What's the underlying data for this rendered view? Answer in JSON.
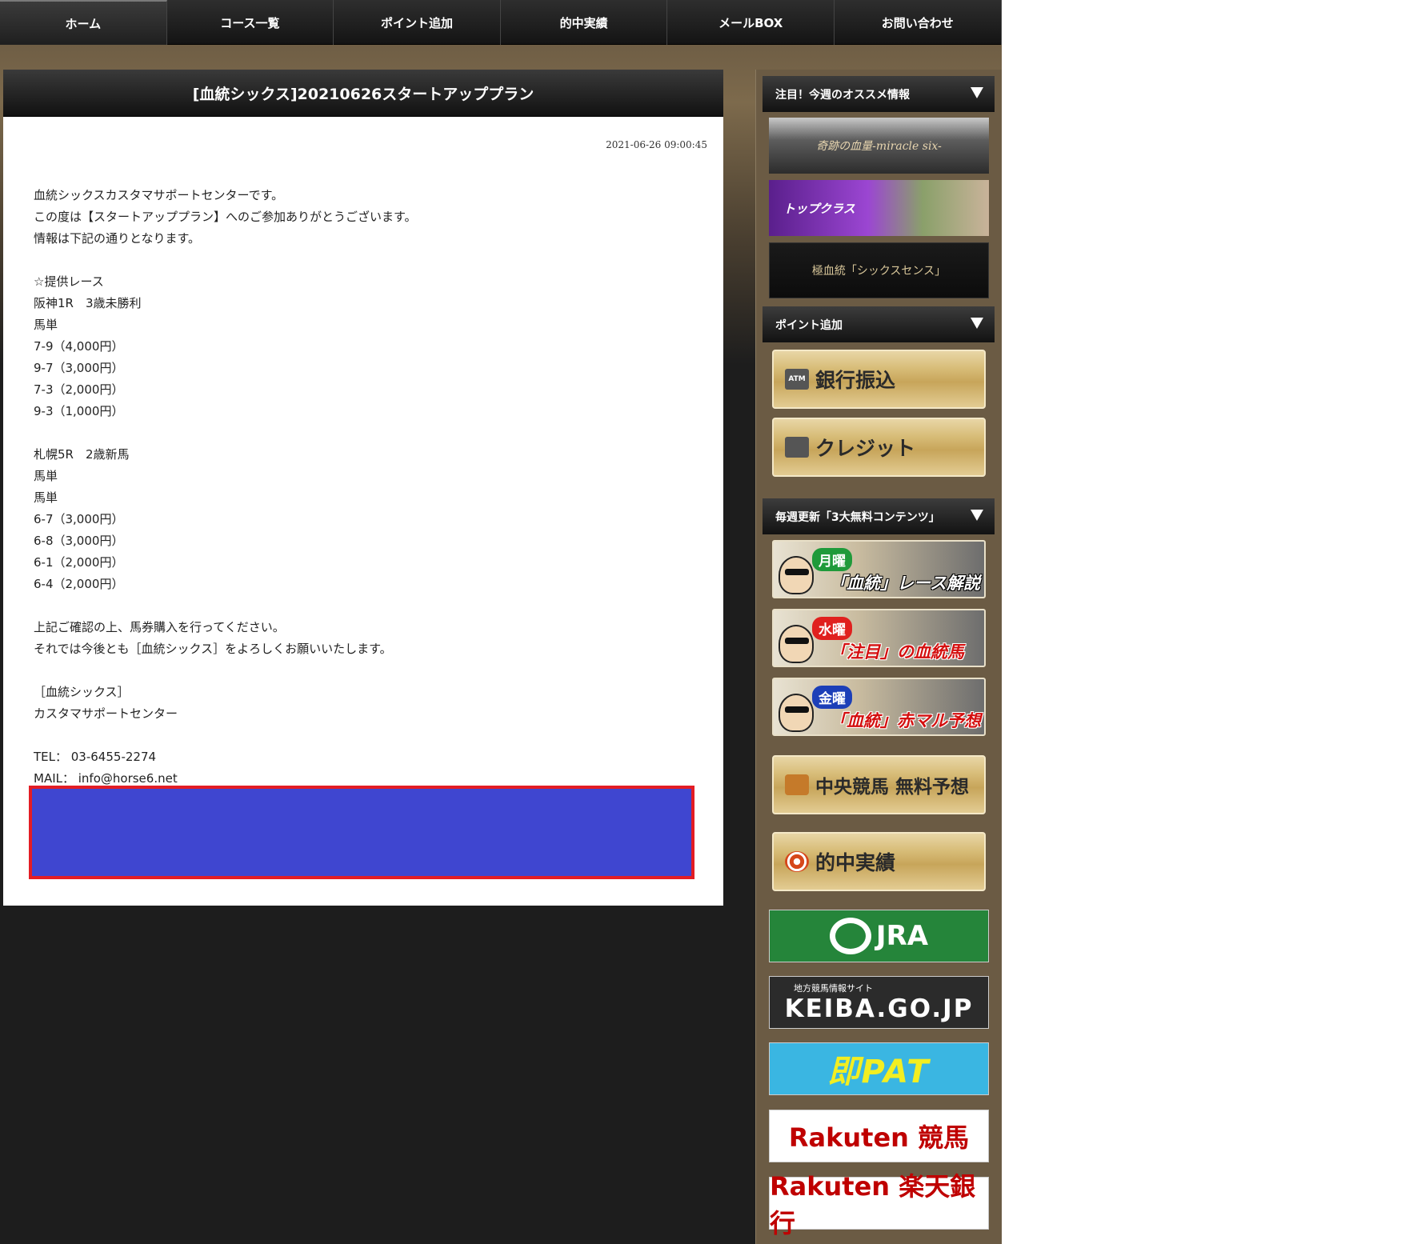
{
  "nav": {
    "items": [
      "ホーム",
      "コース一覧",
      "ポイント追加",
      "的中実績",
      "メールBOX",
      "お問い合わせ"
    ]
  },
  "article": {
    "title": "[血統シックス]20210626スタートアッププラン",
    "date": "2021-06-26 09:00:45",
    "body": "血統シックスカスタマサポートセンターです。\nこの度は【スタートアッププラン】へのご参加ありがとうございます。\n情報は下記の通りとなります。\n\n☆提供レース\n阪神1R　3歳未勝利\n馬単\n7-9（4,000円）\n9-7（3,000円）\n7-3（2,000円）\n9-3（1,000円）\n\n札幌5R　2歳新馬\n馬単\n馬単\n6-7（3,000円）\n6-8（3,000円）\n6-1（2,000円）\n6-4（2,000円）\n\n上記ご確認の上、馬券購入を行ってください。\nそれでは今後とも［血統シックス］をよろしくお願いいたします。\n\n［血統シックス］\nカスタマサポートセンター\n\nTEL： 03-6455-2274\nMAIL： info@horse6.net"
  },
  "sidebar": {
    "section1": {
      "title": "注目！今週のオススメ情報",
      "banners": [
        "奇跡の血量-miracle six-",
        "トップクラス",
        "極血統「シックスセンス」"
      ]
    },
    "section2": {
      "title": "ポイント追加",
      "buttons": [
        "銀行振込",
        "クレジット"
      ],
      "atm_label": "ATM"
    },
    "section3": {
      "title": "毎週更新「3大無料コンテンツ」",
      "days": [
        {
          "day": "月曜",
          "title": "「血統」レース解説",
          "color": "#1f9a3a"
        },
        {
          "day": "水曜",
          "title": "「注目」の血統馬",
          "color": "#e0201e"
        },
        {
          "day": "金曜",
          "title": "「血統」赤マル予想",
          "color": "#1c3fb8"
        }
      ],
      "buttons": [
        "中央競馬 無料予想",
        "的中実績"
      ]
    },
    "links": {
      "jra": "JRA",
      "keiba_small": "地方競馬情報サイト",
      "keiba_big": "KEIBA.GO.JP",
      "pat": "即PAT",
      "rakuten_keiba": "Rakuten 競馬",
      "rakuten_bank": "Rakuten 楽天銀行"
    }
  },
  "colors": {
    "ad_fill": "#3f46d0",
    "ad_border": "#e31d25"
  }
}
